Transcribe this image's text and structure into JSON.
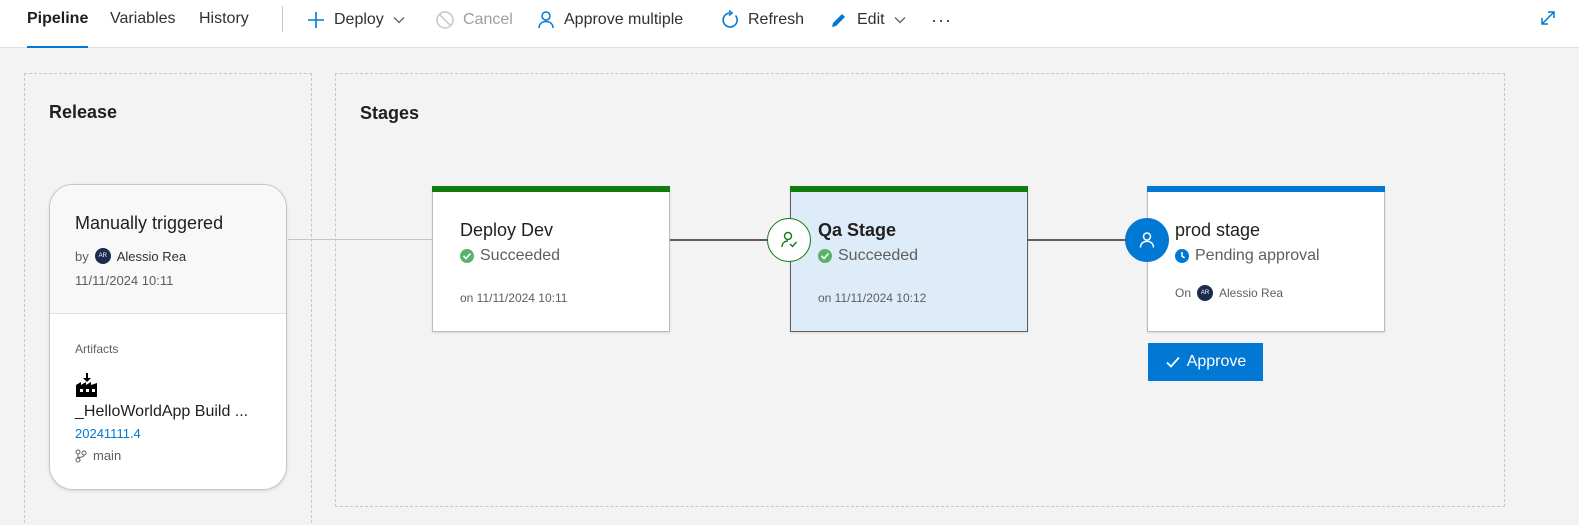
{
  "tabs": {
    "pipeline": "Pipeline",
    "variables": "Variables",
    "history": "History"
  },
  "toolbar": {
    "deploy": "Deploy",
    "cancel": "Cancel",
    "approve_multiple": "Approve multiple",
    "refresh": "Refresh",
    "edit": "Edit",
    "more": "···"
  },
  "release": {
    "heading": "Release",
    "trigger": "Manually triggered",
    "by_label": "by",
    "user_initials": "AR",
    "user_name": "Alessio Rea",
    "date": "11/11/2024 10:11",
    "artifacts_label": "Artifacts",
    "artifact_name": "_HelloWorldApp Build ...",
    "artifact_version": "20241111.4",
    "branch": "main"
  },
  "stages": {
    "heading": "Stages",
    "items": [
      {
        "name": "Deploy Dev",
        "status": "Succeeded",
        "date": "on 11/11/2024 10:11"
      },
      {
        "name": "Qa Stage",
        "status": "Succeeded",
        "date": "on 11/11/2024 10:12"
      },
      {
        "name": "prod stage",
        "status": "Pending approval",
        "on_label": "On",
        "user_initials": "AR",
        "user_name": "Alessio Rea"
      }
    ]
  },
  "approve_button": "Approve",
  "colors": {
    "accent": "#0078d4",
    "success": "#107c10",
    "success_icon": "#5bb36b",
    "selected_bg": "#deecf9"
  }
}
